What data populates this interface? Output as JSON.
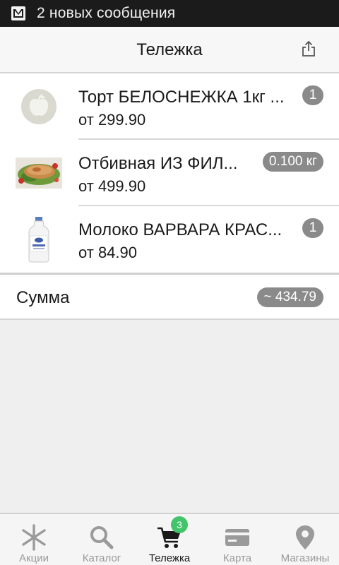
{
  "status_bar": {
    "notification_icon": "mail-icon",
    "text": "2 новых сообщения"
  },
  "header": {
    "title": "Тележка",
    "share_icon": "share-icon"
  },
  "cart": {
    "items": [
      {
        "name": "Торт БЕЛОСНЕЖКА 1кг ...",
        "price": "от 299.90",
        "quantity": "1",
        "image": "placeholder-apple-image"
      },
      {
        "name": "Отбивная ИЗ ФИЛ...",
        "price": "от 499.90",
        "quantity": "0.100 кг",
        "image": "meat-dish-photo"
      },
      {
        "name": "Молоко ВАРВАРА КРАС...",
        "price": "от 84.90",
        "quantity": "1",
        "image": "milk-bottle-photo"
      }
    ],
    "sum_label": "Сумма",
    "sum_value": "~ 434.79"
  },
  "tabs": [
    {
      "label": "Акции",
      "icon": "asterisk-icon",
      "active": false
    },
    {
      "label": "Каталог",
      "icon": "search-icon",
      "active": false
    },
    {
      "label": "Тележка",
      "icon": "cart-icon",
      "active": true,
      "badge": "3"
    },
    {
      "label": "Карта",
      "icon": "credit-card-icon",
      "active": false
    },
    {
      "label": "Магазины",
      "icon": "location-pin-icon",
      "active": false
    }
  ],
  "colors": {
    "status_bar_bg": "#1b1b1b",
    "badge_grey": "#8a8a8a",
    "cart_count_green": "#43c46a",
    "active_tab_text": "#1a1a1a",
    "inactive_tab": "#9a9a9a"
  }
}
